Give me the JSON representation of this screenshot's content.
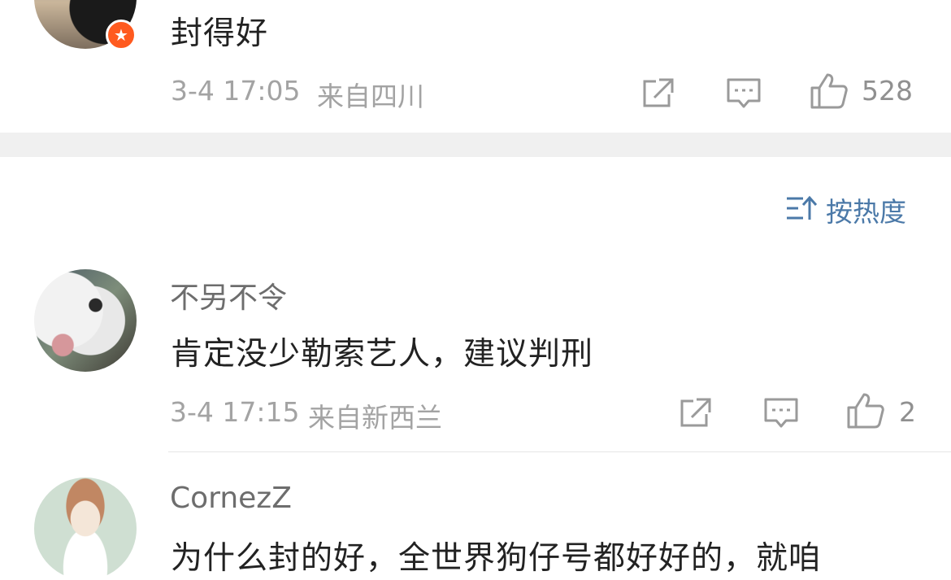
{
  "comments_top": {
    "text": "封得好",
    "time": "3-4 17:05",
    "location": "来自四川",
    "like_count": "528",
    "badge_icon": "verified-badge-icon"
  },
  "sort": {
    "label": "按热度",
    "icon": "sort-icon"
  },
  "comments": [
    {
      "username": "不另不令",
      "text": "肯定没少勒索艺人，建议判刑",
      "time": "3-4 17:15",
      "location": "来自新西兰",
      "like_count": "2"
    },
    {
      "username": "CornezZ",
      "text": "为什么封的好，全世界狗仔号都好好的，就咱"
    }
  ],
  "colors": {
    "meta": "#a3a3a3",
    "link_blue": "#4b79a8",
    "badge": "#ff5a1f",
    "section_gap": "#f0f0f0"
  }
}
